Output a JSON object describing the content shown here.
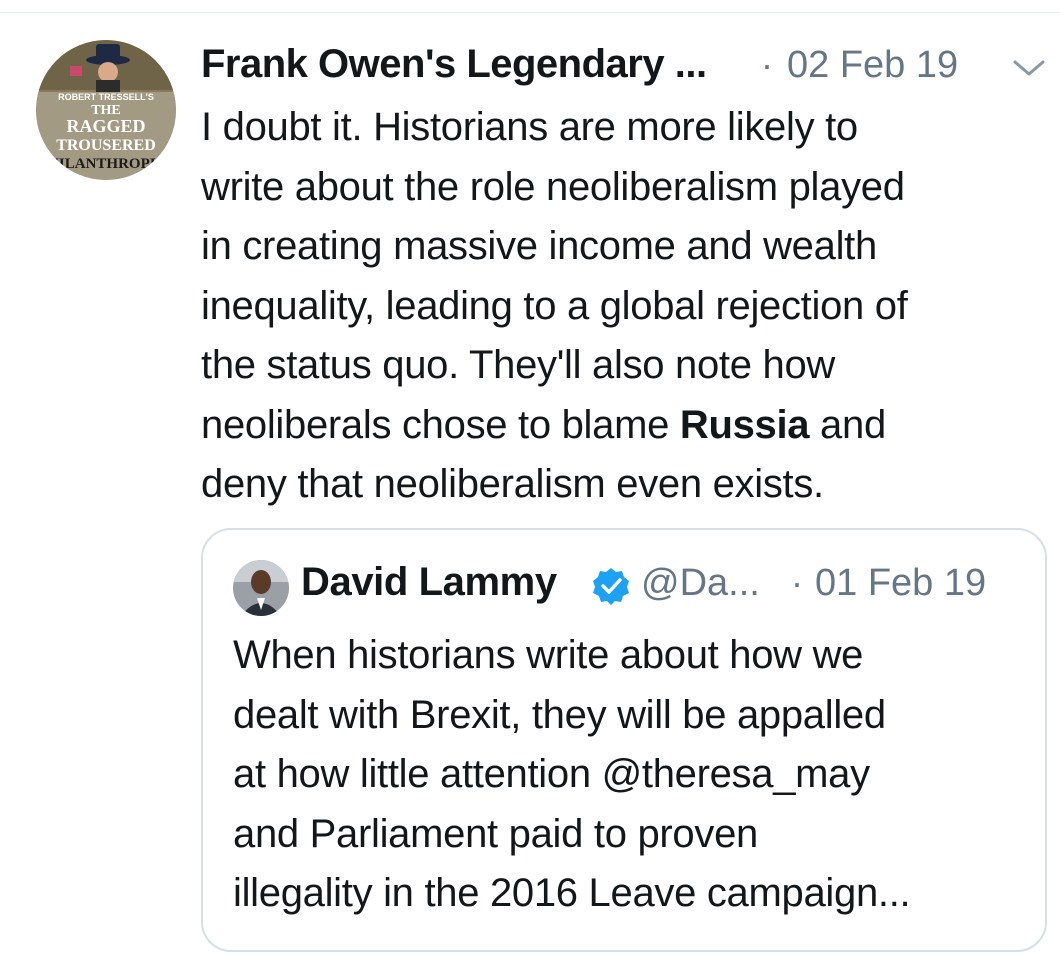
{
  "tweet": {
    "author": {
      "display_name": "Frank Owen's Legendary ...",
      "avatar_text": [
        "ROBERT TRESSELL'S",
        "THE",
        "RAGGED",
        "TROUSERED",
        "PHILANTHROPIST"
      ]
    },
    "separator": "·",
    "timestamp": "02 Feb 19",
    "menu_icon": "chevron-down-icon",
    "text_lines": [
      "I doubt it. Historians are more likely to",
      "write about the role neoliberalism played",
      "in creating massive income and wealth",
      "inequality, leading to a global rejection of",
      "the status quo. They'll also note how"
    ],
    "text_line6_before": "neoliberals chose to blame ",
    "text_line6_bold": "Russia",
    "text_line6_after": " and",
    "text_line7": "deny that neoliberalism even exists."
  },
  "quoted_tweet": {
    "display_name": "David Lammy",
    "verified_icon": "verified-badge-icon",
    "handle": "@Da...",
    "separator": "·",
    "timestamp": "01 Feb 19",
    "text_lines": [
      "When historians write about how we",
      "dealt with Brexit, they will be appalled",
      "at how little attention @theresa_may",
      "and Parliament paid to proven",
      "illegality in the 2016 Leave campaign..."
    ]
  },
  "colors": {
    "text_primary": "#14171a",
    "text_secondary": "#657786",
    "border": "#d8dfe4",
    "verified_blue": "#1da1f2"
  }
}
